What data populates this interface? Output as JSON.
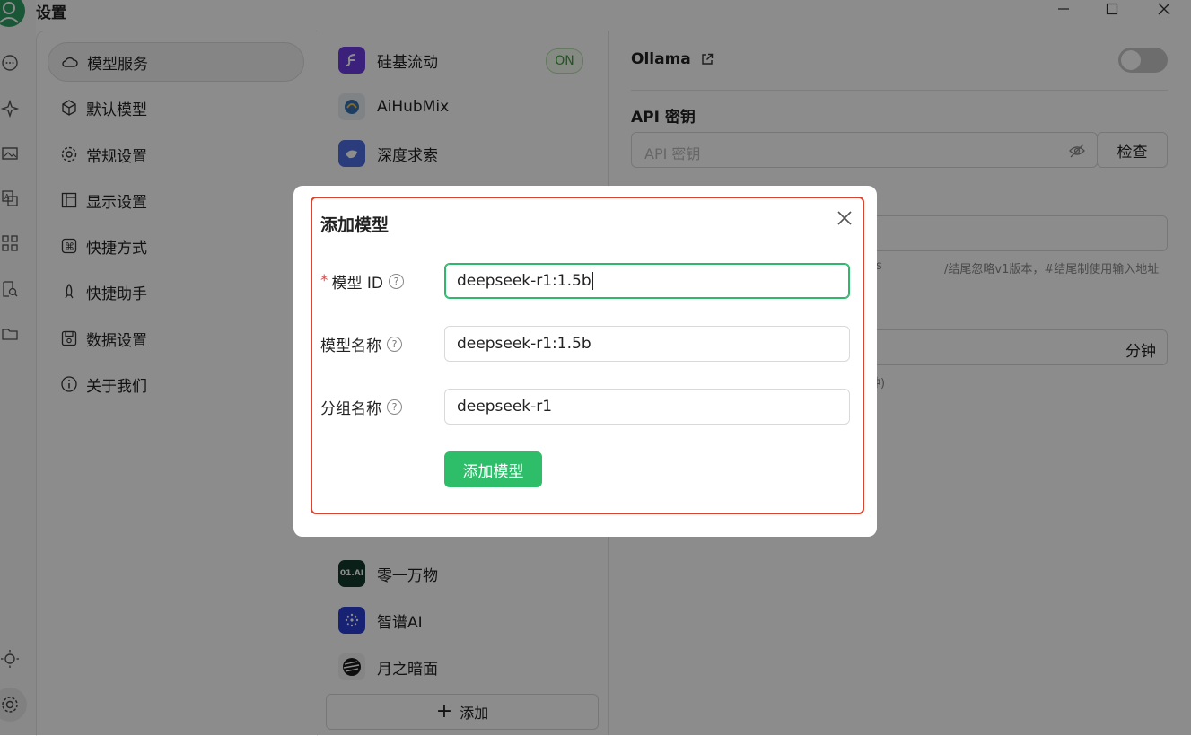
{
  "window": {
    "title": "设置"
  },
  "nav": {
    "items": [
      {
        "label": "模型服务",
        "icon": "cloud-icon",
        "active": true
      },
      {
        "label": "默认模型",
        "icon": "cube-icon"
      },
      {
        "label": "常规设置",
        "icon": "gear-icon"
      },
      {
        "label": "显示设置",
        "icon": "layout-icon"
      },
      {
        "label": "快捷方式",
        "icon": "command-icon"
      },
      {
        "label": "快捷助手",
        "icon": "rocket-icon"
      },
      {
        "label": "数据设置",
        "icon": "save-icon"
      },
      {
        "label": "关于我们",
        "icon": "info-icon"
      }
    ]
  },
  "providers": {
    "top": [
      {
        "name": "硅基流动",
        "badge": "ON",
        "color": "#6c3ce0"
      },
      {
        "name": "AiHubMix",
        "color": "#e9eef5"
      },
      {
        "name": "深度求索",
        "color": "#4e6ee0"
      }
    ],
    "bottom": [
      {
        "name": "零一万物",
        "logo_text": "01.AI",
        "color": "#123a2a"
      },
      {
        "name": "智谱AI",
        "color": "#2d3fd4"
      },
      {
        "name": "月之暗面",
        "color": "#1a1a1a"
      }
    ],
    "add_label": "添加"
  },
  "detail": {
    "provider_name": "Ollama",
    "api_key_heading": "API 密钥",
    "api_key_placeholder": "API 密钥",
    "check_label": "检查",
    "hint_suffix": "/结尾忽略v1版本，#结尾制使用输入地址",
    "hint_prefix": "s",
    "minutes_unit": "分钟",
    "minutes_hint": "钟)"
  },
  "modal": {
    "title": "添加模型",
    "fields": [
      {
        "label": "模型 ID",
        "required": true,
        "value": "deepseek-r1:1.5b",
        "focused": true
      },
      {
        "label": "模型名称",
        "required": false,
        "value": "deepseek-r1:1.5b"
      },
      {
        "label": "分组名称",
        "required": false,
        "value": "deepseek-r1"
      }
    ],
    "submit_label": "添加模型",
    "help_glyph": "?"
  },
  "colors": {
    "accent": "#2ebe6a",
    "highlight_outline": "#d9432f"
  }
}
